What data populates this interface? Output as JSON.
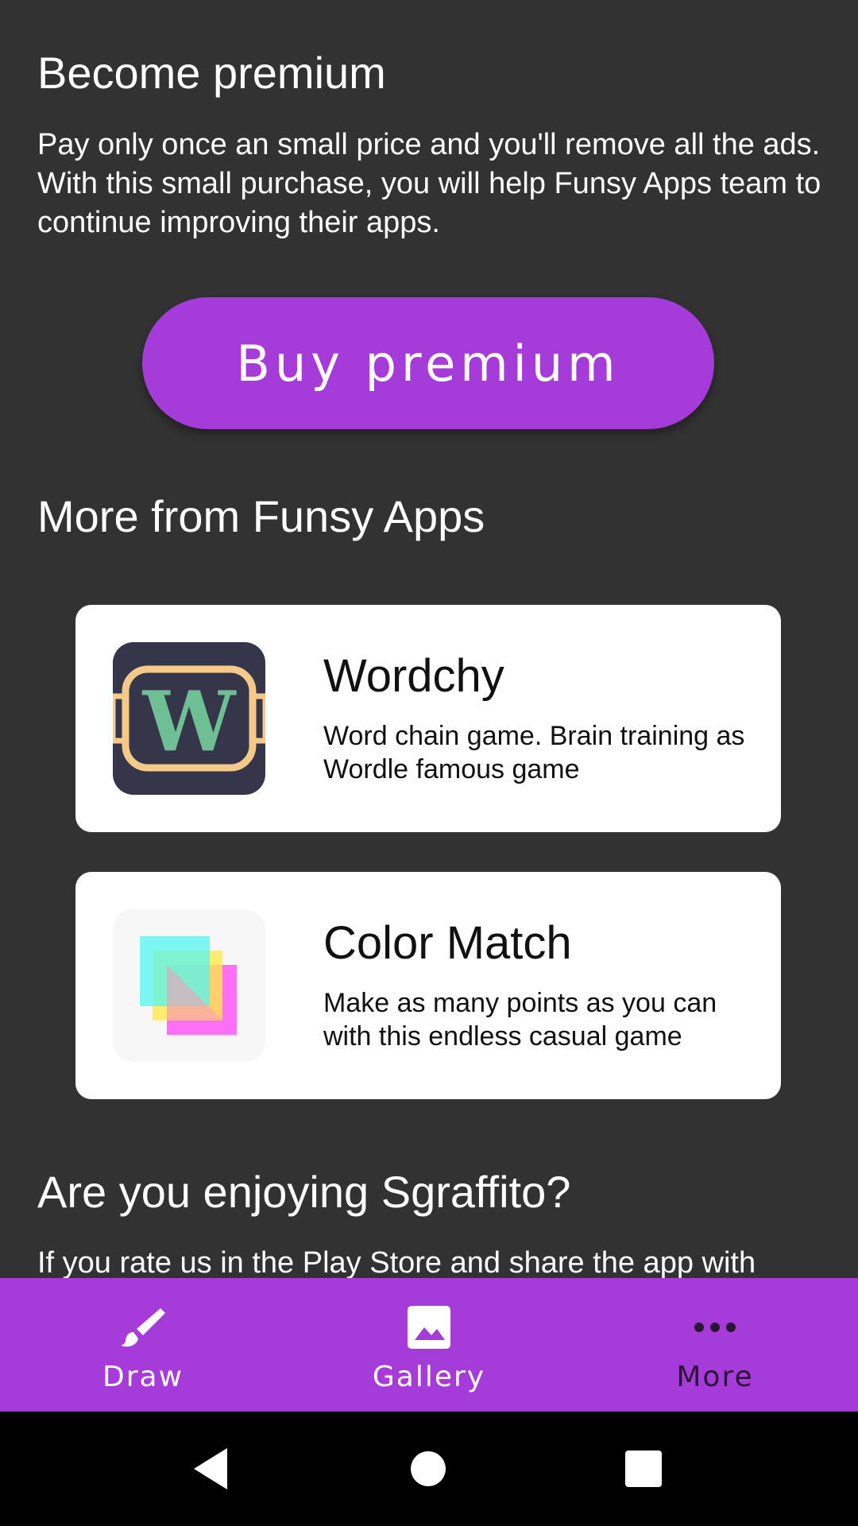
{
  "premium": {
    "title": "Become premium",
    "description": "Pay only once an small price and you'll remove all the ads. With this small purchase, you will help Funsy Apps team to continue improving their apps.",
    "buy_label": "Buy premium",
    "accent_color": "#a53bd9"
  },
  "more_apps": {
    "title": "More from Funsy Apps",
    "apps": [
      {
        "name": "Wordchy",
        "description": "Word chain game. Brain training as Wordle famous game",
        "icon": "wordchy-logo-icon",
        "icon_letter": "W"
      },
      {
        "name": "Color Match",
        "description": "Make as many points as you can with this endless casual game",
        "icon": "color-match-logo-icon"
      }
    ]
  },
  "rate": {
    "title": "Are you enjoying Sgraffito?",
    "text": "If you rate us in the Play Store and share the app with"
  },
  "bottom_nav": {
    "items": [
      {
        "label": "Draw",
        "icon": "brush-icon",
        "active": false
      },
      {
        "label": "Gallery",
        "icon": "image-icon",
        "active": false
      },
      {
        "label": "More",
        "icon": "more-dots-icon",
        "active": true
      }
    ]
  },
  "system_nav": {
    "back": "back-icon",
    "home": "home-icon",
    "recents": "recents-icon"
  }
}
